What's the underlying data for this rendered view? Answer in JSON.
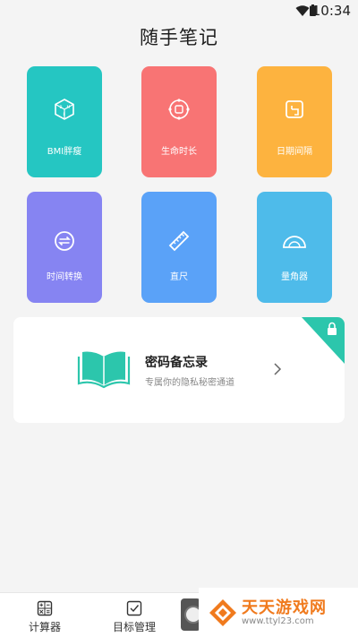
{
  "status_bar": {
    "time": "10:34"
  },
  "app": {
    "title": "随手笔记"
  },
  "tools": [
    {
      "label": "BMI胖瘦",
      "color": "#25c6c2",
      "icon": "bmi-cube-icon"
    },
    {
      "label": "生命时长",
      "color": "#f87474",
      "icon": "life-clock-icon"
    },
    {
      "label": "日期间隔",
      "color": "#fdb33f",
      "icon": "date-interval-icon"
    },
    {
      "label": "时间转换",
      "color": "#8684f2",
      "icon": "time-convert-icon"
    },
    {
      "label": "直尺",
      "color": "#5aa2f8",
      "icon": "ruler-icon"
    },
    {
      "label": "量角器",
      "color": "#4ebbea",
      "icon": "protractor-icon"
    }
  ],
  "memo": {
    "title": "密码备忘录",
    "subtitle": "专属你的隐私秘密通道",
    "accent": "#2cc6ac"
  },
  "bottom_nav": [
    {
      "label": "计算器",
      "icon": "calculator-icon"
    },
    {
      "label": "目标管理",
      "icon": "goal-check-icon"
    }
  ],
  "watermark": {
    "name": "天天游戏网",
    "url": "www.ttyl23.com"
  }
}
